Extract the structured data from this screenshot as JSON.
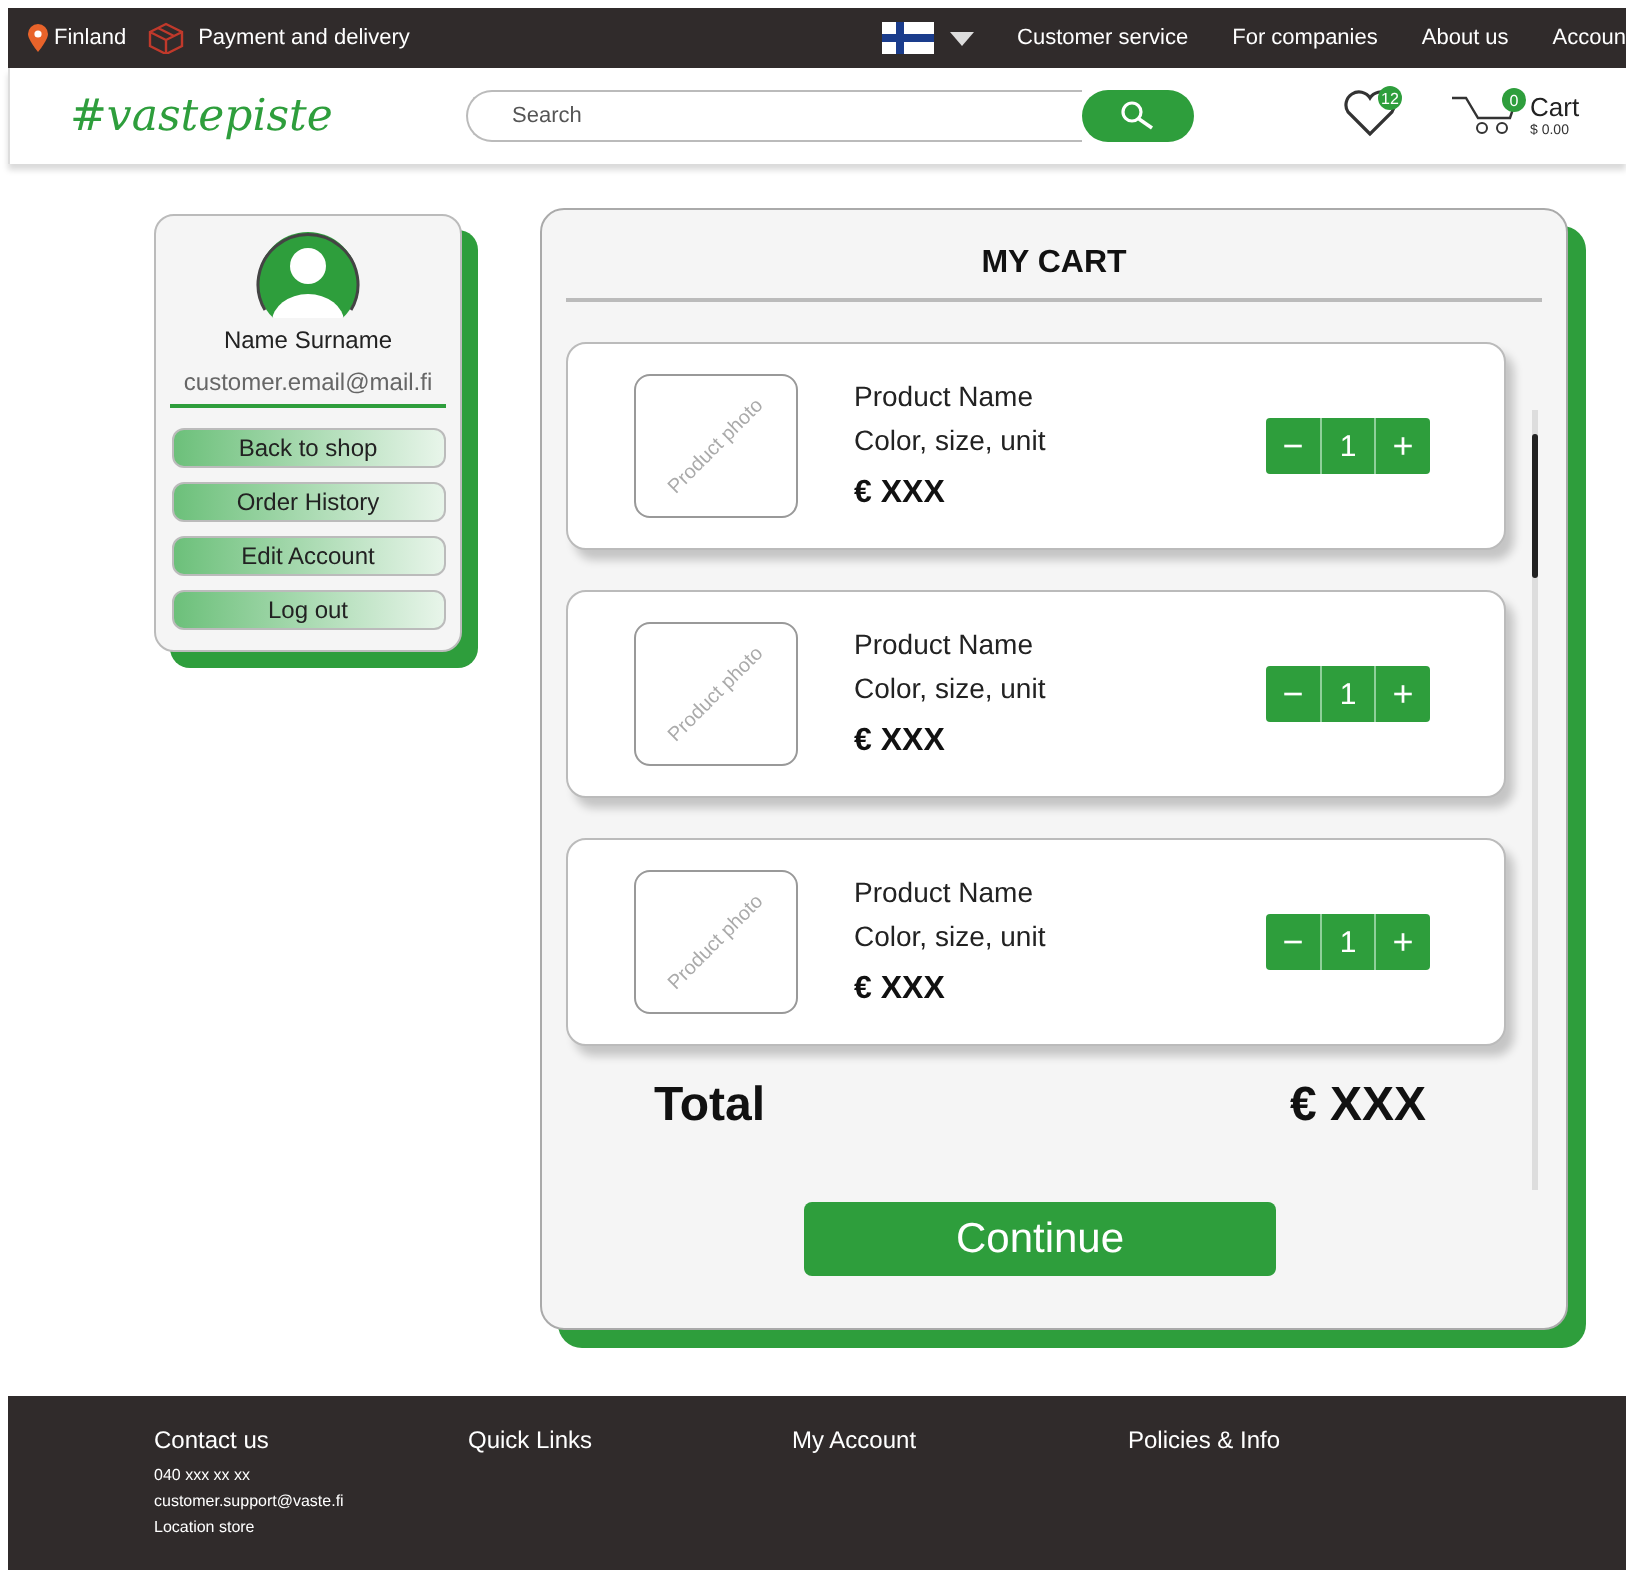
{
  "top_bar": {
    "location": "Finland",
    "delivery": "Payment and delivery",
    "links": [
      "Customer service",
      "For companies",
      "About us",
      "Accoun"
    ]
  },
  "header": {
    "logo": "#vastepiste",
    "search": {
      "placeholder": "Search"
    },
    "wishlist_count": "12",
    "cart": {
      "count": "0",
      "label": "Cart",
      "total": "$ 0.00"
    }
  },
  "profile": {
    "name": "Name Surname",
    "email": "customer.email@mail.fi",
    "buttons": [
      "Back to shop",
      "Order History",
      "Edit Account",
      "Log out"
    ]
  },
  "cart": {
    "title": "MY CART",
    "items": [
      {
        "photo_label": "Product photo",
        "name": "Product Name",
        "details": "Color, size, unit",
        "price": "€ XXX",
        "decrement": "−",
        "quantity": "1",
        "increment": "+"
      },
      {
        "photo_label": "Product photo",
        "name": "Product Name",
        "details": "Color, size, unit",
        "price": "€ XXX",
        "decrement": "−",
        "quantity": "1",
        "increment": "+"
      },
      {
        "photo_label": "Product photo",
        "name": "Product Name",
        "details": "Color, size, unit",
        "price": "€ XXX",
        "decrement": "−",
        "quantity": "1",
        "increment": "+"
      }
    ],
    "total_label": "Total",
    "total": "€ XXX",
    "continue": "Continue"
  },
  "footer": {
    "columns": [
      {
        "title": "Contact us",
        "lines": [
          "040 xxx xx xx",
          "customer.support@vaste.fi",
          "Location store"
        ]
      },
      {
        "title": "Quick Links"
      },
      {
        "title": "My Account"
      },
      {
        "title": "Policies & Info"
      }
    ]
  }
}
